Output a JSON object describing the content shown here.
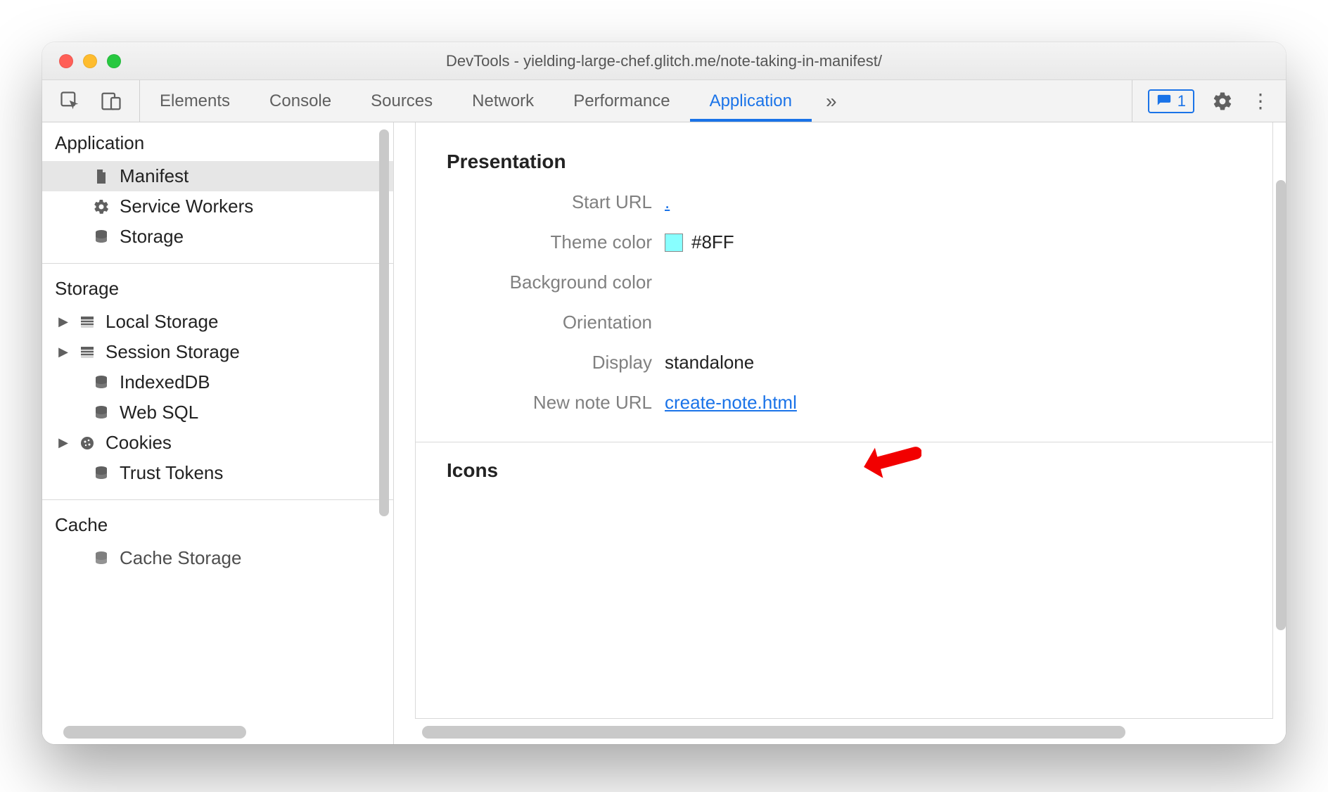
{
  "window": {
    "title": "DevTools - yielding-large-chef.glitch.me/note-taking-in-manifest/"
  },
  "tabs": {
    "elements": "Elements",
    "console": "Console",
    "sources": "Sources",
    "network": "Network",
    "performance": "Performance",
    "application": "Application",
    "more": "»"
  },
  "issues": {
    "count": "1"
  },
  "sidebar": {
    "sections": {
      "application": {
        "title": "Application",
        "items": {
          "manifest": "Manifest",
          "service_workers": "Service Workers",
          "storage": "Storage"
        }
      },
      "storage": {
        "title": "Storage",
        "items": {
          "local_storage": "Local Storage",
          "session_storage": "Session Storage",
          "indexeddb": "IndexedDB",
          "web_sql": "Web SQL",
          "cookies": "Cookies",
          "trust_tokens": "Trust Tokens"
        }
      },
      "cache": {
        "title": "Cache",
        "items": {
          "cache_storage": "Cache Storage"
        }
      }
    }
  },
  "manifest": {
    "section_presentation": "Presentation",
    "section_icons": "Icons",
    "rows": {
      "start_url": {
        "label": "Start URL",
        "value": "."
      },
      "theme_color": {
        "label": "Theme color",
        "value": "#8FF",
        "swatch": "#88ffff"
      },
      "background_color": {
        "label": "Background color",
        "value": ""
      },
      "orientation": {
        "label": "Orientation",
        "value": ""
      },
      "display": {
        "label": "Display",
        "value": "standalone"
      },
      "new_note_url": {
        "label": "New note URL",
        "value": "create-note.html"
      }
    }
  }
}
